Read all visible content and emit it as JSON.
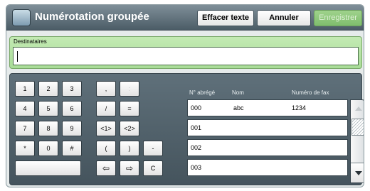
{
  "header": {
    "title": "Numérotation groupée",
    "clear_text": "Effacer texte",
    "cancel": "Annuler",
    "save": "Enregistrer"
  },
  "recipients": {
    "label": "Destinataires",
    "value": ""
  },
  "keypad": {
    "row1": [
      "1",
      "2",
      "3",
      ",",
      ":"
    ],
    "row2": [
      "4",
      "5",
      "6",
      "/",
      "="
    ],
    "row3": [
      "7",
      "8",
      "9",
      "<1>",
      "<2>"
    ],
    "row4": [
      "*",
      "0",
      "#",
      "(",
      ")",
      "-"
    ],
    "row5": [
      "⇦",
      "⇨",
      "C"
    ]
  },
  "list": {
    "headers": {
      "short": "N° abrégé",
      "name": "Nom",
      "fax": "Numéro de fax"
    },
    "rows": [
      {
        "id": "000",
        "name": "abc",
        "fax": "1234"
      },
      {
        "id": "001",
        "name": "",
        "fax": ""
      },
      {
        "id": "002",
        "name": "",
        "fax": ""
      },
      {
        "id": "003",
        "name": "",
        "fax": ""
      }
    ]
  },
  "icons": {
    "title": "fax-icon",
    "scroll_up": "chevron-up-icon",
    "scroll_down": "chevron-down-icon"
  },
  "colors": {
    "titlebar": "#5a6b75",
    "recipients_panel": "#b5e3a3",
    "save_button": "#8cc67a"
  }
}
